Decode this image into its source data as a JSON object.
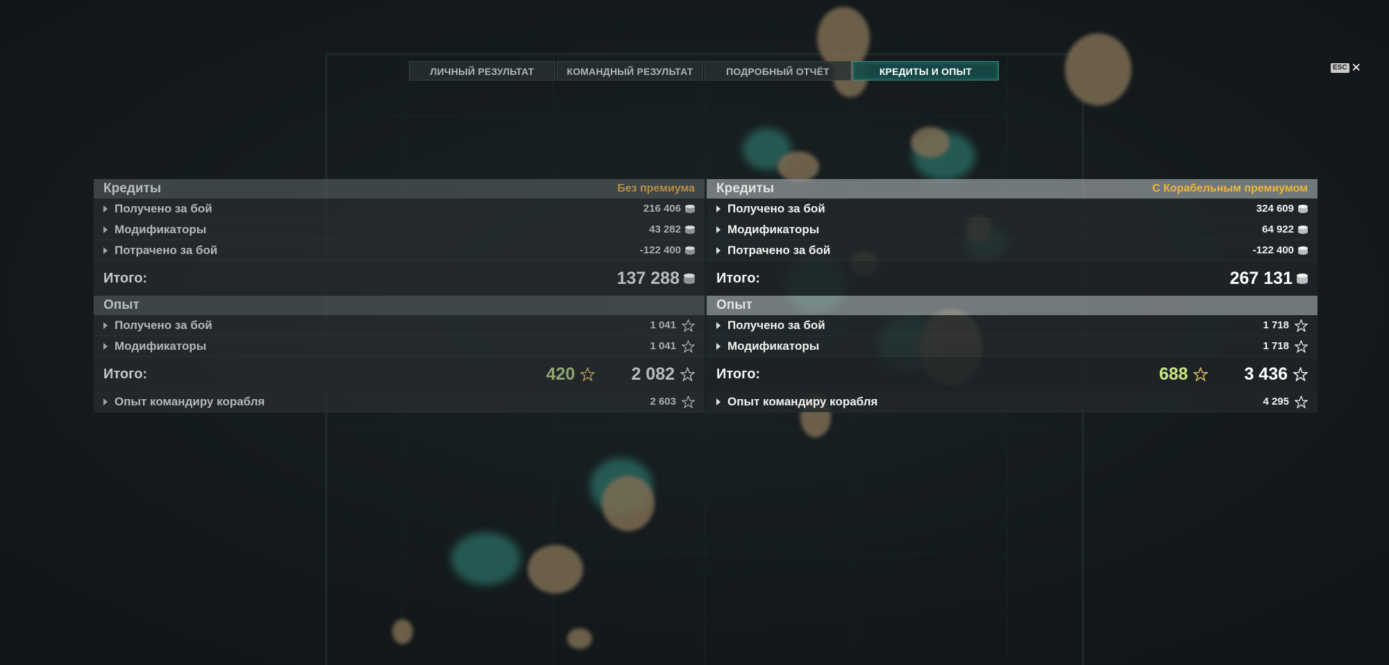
{
  "tabs": [
    {
      "label": "ЛИЧНЫЙ РЕЗУЛЬТАТ",
      "active": false
    },
    {
      "label": "КОМАНДНЫЙ РЕЗУЛЬТАТ",
      "active": false
    },
    {
      "label": "ПОДРОБНЫЙ ОТЧЁТ",
      "active": false
    },
    {
      "label": "КРЕДИТЫ И ОПЫТ",
      "active": true
    }
  ],
  "esc": {
    "key": "ESC",
    "close": "✕"
  },
  "left": {
    "credits": {
      "title": "Кредиты",
      "subtitle": "Без премиума",
      "rows": [
        {
          "label": "Получено за бой",
          "value": "216 406"
        },
        {
          "label": "Модификаторы",
          "value": "43 282"
        },
        {
          "label": "Потрачено за бой",
          "value": "-122 400"
        }
      ],
      "total_label": "Итого:",
      "total_value": "137 288"
    },
    "exp": {
      "title": "Опыт",
      "rows": [
        {
          "label": "Получено за бой",
          "value": "1 041"
        },
        {
          "label": "Модификаторы",
          "value": "1 041"
        }
      ],
      "total_label": "Итого:",
      "total_free": "420",
      "total_value": "2 082",
      "commander_label": "Опыт командиру корабля",
      "commander_value": "2 603"
    }
  },
  "right": {
    "credits": {
      "title": "Кредиты",
      "subtitle": "С Корабельным премиумом",
      "rows": [
        {
          "label": "Получено за бой",
          "value": "324 609"
        },
        {
          "label": "Модификаторы",
          "value": "64 922"
        },
        {
          "label": "Потрачено за бой",
          "value": "-122 400"
        }
      ],
      "total_label": "Итого:",
      "total_value": "267 131"
    },
    "exp": {
      "title": "Опыт",
      "rows": [
        {
          "label": "Получено за бой",
          "value": "1 718"
        },
        {
          "label": "Модификаторы",
          "value": "1 718"
        }
      ],
      "total_label": "Итого:",
      "total_free": "688",
      "total_value": "3 436",
      "commander_label": "Опыт командиру корабля",
      "commander_value": "4 295"
    }
  },
  "colors": {
    "accent_teal": "#164a48",
    "premium_gold": "#f0b63c",
    "free_exp_green": "#c9e784"
  }
}
